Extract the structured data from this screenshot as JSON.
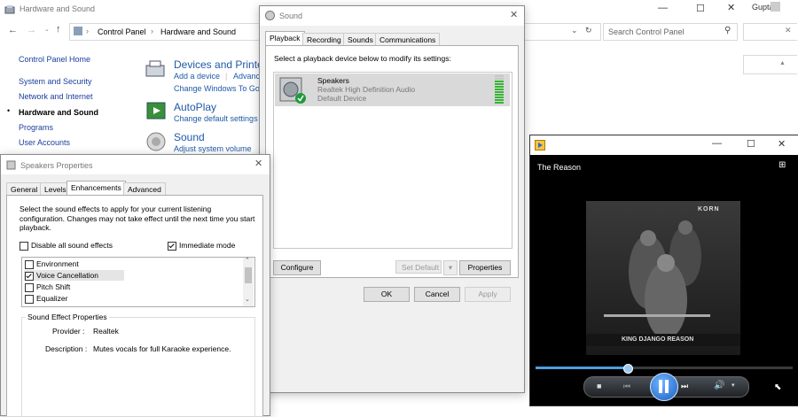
{
  "cp": {
    "title": "Hardware and Sound",
    "user": "Gupta",
    "breadcrumb": [
      "Control Panel",
      "Hardware and Sound"
    ],
    "search_placeholder": "Search Control Panel",
    "sidebar": [
      "Control Panel Home",
      "System and Security",
      "Network and Internet",
      "Hardware and Sound",
      "Programs",
      "User Accounts"
    ],
    "categories": [
      {
        "title": "Devices and Printe",
        "links": [
          "Add a device",
          "Advanc",
          "Change Windows To Go"
        ]
      },
      {
        "title": "AutoPlay",
        "links": [
          "Change default settings"
        ]
      },
      {
        "title": "Sound",
        "links": [
          "Adjust system volume"
        ]
      }
    ]
  },
  "sound": {
    "title": "Sound",
    "tabs": [
      "Playback",
      "Recording",
      "Sounds",
      "Communications"
    ],
    "instruction": "Select a playback device below to modify its settings:",
    "device": {
      "name": "Speakers",
      "driver": "Realtek High Definition Audio",
      "status": "Default Device"
    },
    "buttons": {
      "configure": "Configure",
      "set_default": "Set Default",
      "properties": "Properties",
      "ok": "OK",
      "cancel": "Cancel",
      "apply": "Apply"
    }
  },
  "speakers": {
    "title": "Speakers Properties",
    "tabs": [
      "General",
      "Levels",
      "Enhancements",
      "Advanced"
    ],
    "desc": "Select the sound effects to apply for your current listening configuration. Changes may not take effect until the next time you start playback.",
    "disable_all": "Disable all sound effects",
    "immediate": "Immediate mode",
    "effects": [
      {
        "label": "Environment",
        "checked": false
      },
      {
        "label": "Voice Cancellation",
        "checked": true
      },
      {
        "label": "Pitch Shift",
        "checked": false
      },
      {
        "label": "Equalizer",
        "checked": false
      }
    ],
    "group_title": "Sound Effect Properties",
    "provider_label": "Provider :",
    "provider_value": "Realtek",
    "description_label": "Description :",
    "description_value": "Mutes vocals for full Karaoke experience."
  },
  "player": {
    "title": "The Reason",
    "album_artist": "KORN",
    "album_caption": "KING DJANGO REASON",
    "progress": 0.36
  }
}
